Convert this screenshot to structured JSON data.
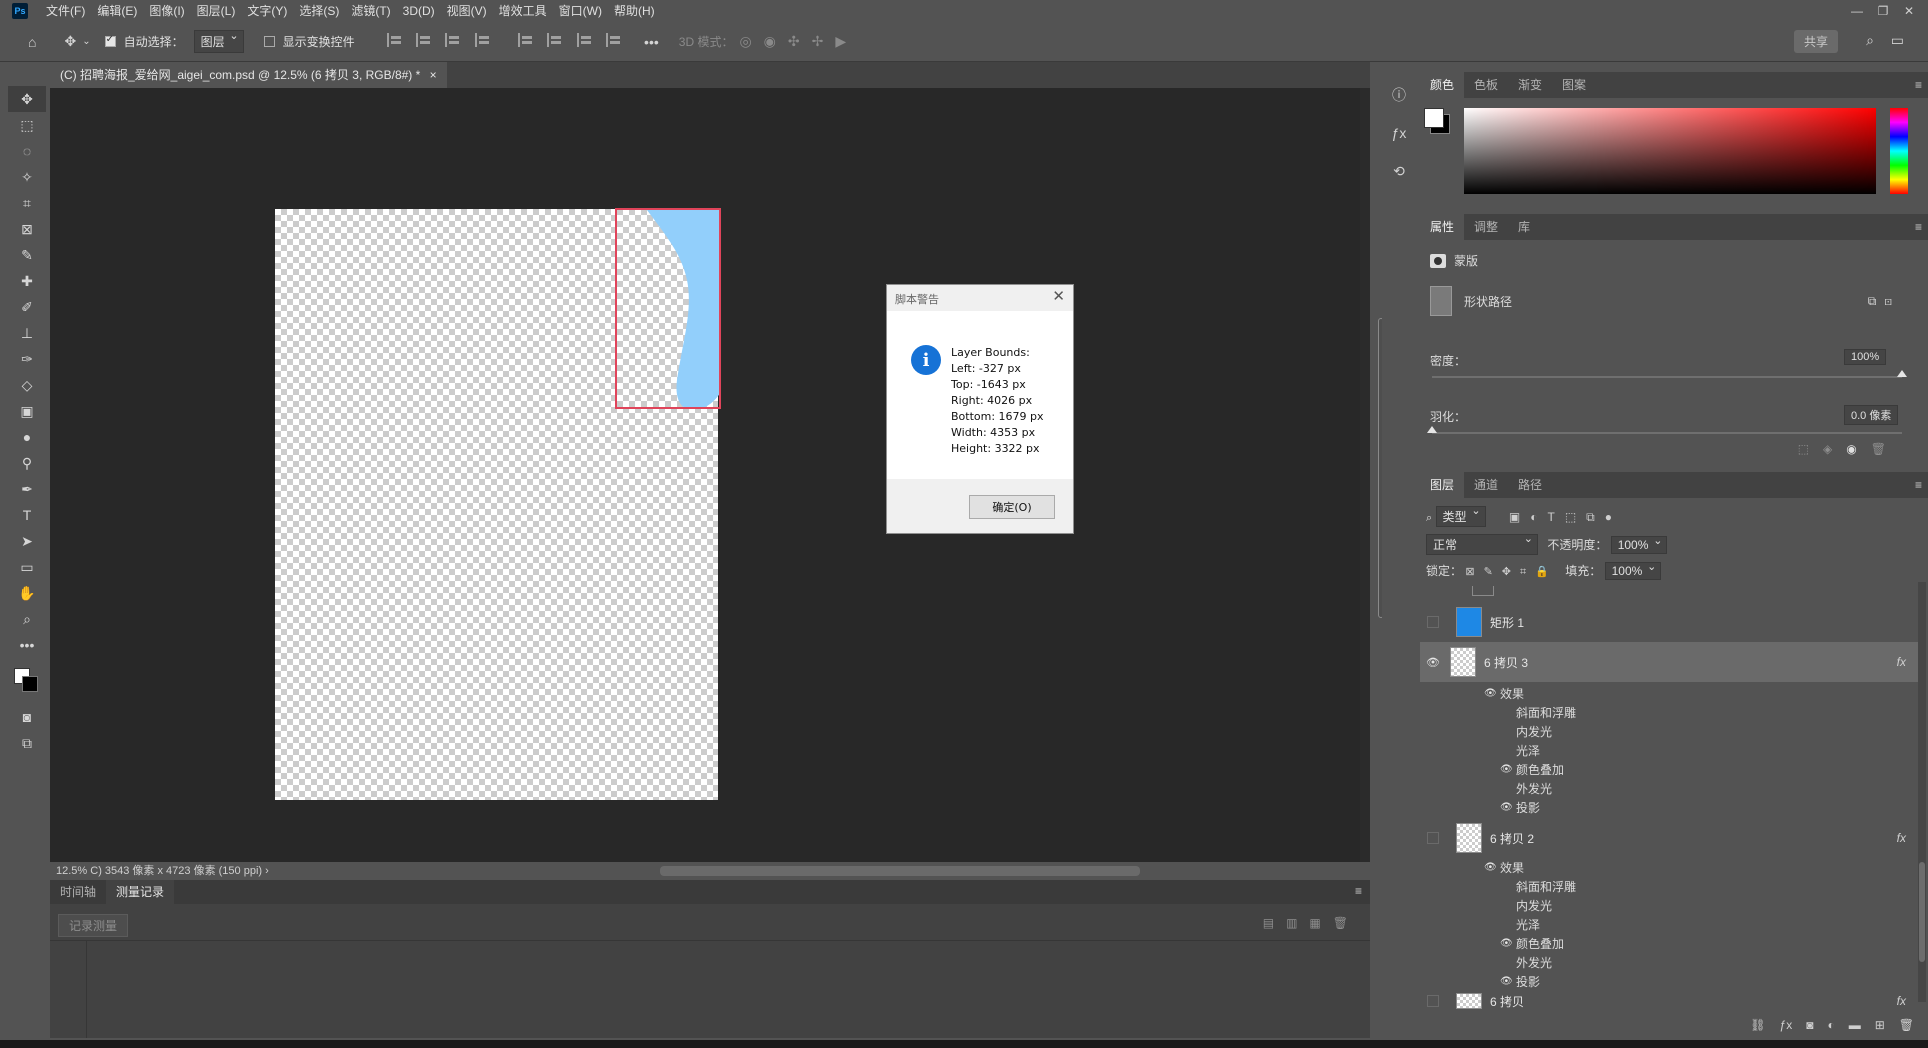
{
  "menu": {
    "app_icon": "Ps",
    "items": [
      "文件(F)",
      "编辑(E)",
      "图像(I)",
      "图层(L)",
      "文字(Y)",
      "选择(S)",
      "滤镜(T)",
      "3D(D)",
      "视图(V)",
      "增效工具",
      "窗口(W)",
      "帮助(H)"
    ],
    "window_controls": [
      "—",
      "❐",
      "✕"
    ]
  },
  "options": {
    "auto_select_label": "自动选择：",
    "auto_select_target": "图层",
    "show_transform_label": "显示变换控件",
    "mode3d_label": "3D 模式：",
    "share_label": "共享"
  },
  "document": {
    "tab_title": "(C) 招聘海报_爱给网_aigei_com.psd @ 12.5% (6 拷贝 3, RGB/8#) *",
    "tab_close": "×"
  },
  "status": {
    "text": "12.5%   C) 3543 像素 x 4723 像素 (150 ppi)   ›"
  },
  "bottom_panel": {
    "tabs": [
      "时间轴",
      "测量记录"
    ],
    "active_tab": 1,
    "record_button": "记录测量"
  },
  "dialog": {
    "title": "脚本警告",
    "close": "✕",
    "icon": "i",
    "lines": [
      "Layer Bounds:",
      "Left: -327 px",
      "Top: -1643 px",
      "Right: 4026 px",
      "Bottom: 1679 px",
      "Width: 4353 px",
      "Height: 3322 px"
    ],
    "ok_label": "确定(O)"
  },
  "color_panel": {
    "tabs": [
      "颜色",
      "色板",
      "渐变",
      "图案"
    ]
  },
  "properties_panel": {
    "tabs": [
      "属性",
      "调整",
      "库"
    ],
    "mask_label": "蒙版",
    "shape_path_label": "形状路径",
    "density_label": "密度：",
    "density_value": "100%",
    "density_level": 1.0,
    "feather_label": "羽化：",
    "feather_value": "0.0 像素",
    "feather_level": 0.0
  },
  "layers_panel": {
    "tabs": [
      "图层",
      "通道",
      "路径"
    ],
    "filter_label": "类型",
    "blend_mode": "正常",
    "opacity_label": "不透明度：",
    "opacity_value": "100%",
    "lock_label": "锁定：",
    "fill_label": "填充：",
    "fill_value": "100%",
    "layers": [
      {
        "name": "矩形 1",
        "fx": ""
      },
      {
        "name": "6 拷贝 3",
        "fx": "fx"
      },
      {
        "name": "6 拷贝 2",
        "fx": "fx"
      },
      {
        "name": "6 拷贝",
        "fx": "fx"
      }
    ],
    "effects_label": "效果",
    "effects_a": [
      "斜面和浮雕",
      "内发光",
      "光泽",
      "颜色叠加",
      "外发光",
      "投影"
    ],
    "effects_b": [
      "斜面和浮雕",
      "内发光",
      "光泽",
      "颜色叠加",
      "外发光",
      "投影"
    ]
  },
  "colors": {
    "selection_border": "#e0445a",
    "shape_fill": "#92cffb",
    "info_blue": "#1672d6"
  }
}
